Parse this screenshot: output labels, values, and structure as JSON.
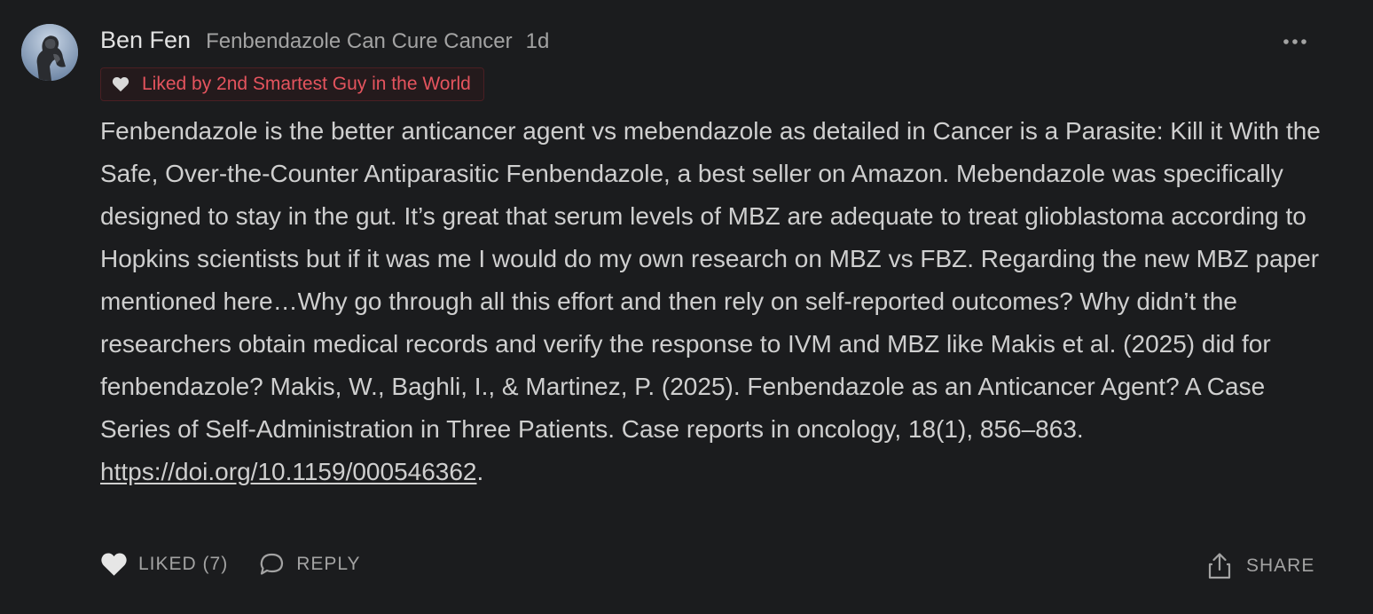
{
  "comment": {
    "author": "Ben Fen",
    "publication": "Fenbendazole Can Cure Cancer",
    "time": "1d",
    "liked_by": "Liked by 2nd Smartest Guy in the World",
    "body": "Fenbendazole is the better anticancer agent vs mebendazole as detailed in Cancer is a Parasite: Kill it With the Safe, Over-the-Counter Antiparasitic Fenbendazole, a best seller on Amazon. Mebendazole was specifically designed to stay in the gut. It’s great that serum levels of MBZ are adequate to treat glioblastoma according to Hopkins scientists but if it was me I would do my own research on MBZ vs FBZ. Regarding the new MBZ paper mentioned here…Why go through all this effort and then rely on self-reported outcomes? Why didn’t the researchers obtain medical records and verify the response to IVM and MBZ like Makis et al. (2025) did for fenbendazole? Makis, W., Baghli, I., & Martinez, P. (2025). Fenbendazole as an Anticancer Agent? A Case Series of Self-Administration in Three Patients. Case reports in oncology, 18(1), 856–863.",
    "link_text": "https://doi.org/10.1159/000546362",
    "link_suffix": "."
  },
  "actions": {
    "like_label": "LIKED (7)",
    "reply_label": "REPLY",
    "share_label": "SHARE"
  },
  "icons": {
    "avatar": "avatar",
    "more": "more-options-icon",
    "heart": "heart-icon",
    "reply": "reply-icon",
    "share": "share-icon"
  },
  "colors": {
    "background": "#1b1c1e",
    "liked_badge_text": "#e5545e",
    "body_text": "#cfcfcf",
    "muted_text": "#a3a3a3"
  }
}
